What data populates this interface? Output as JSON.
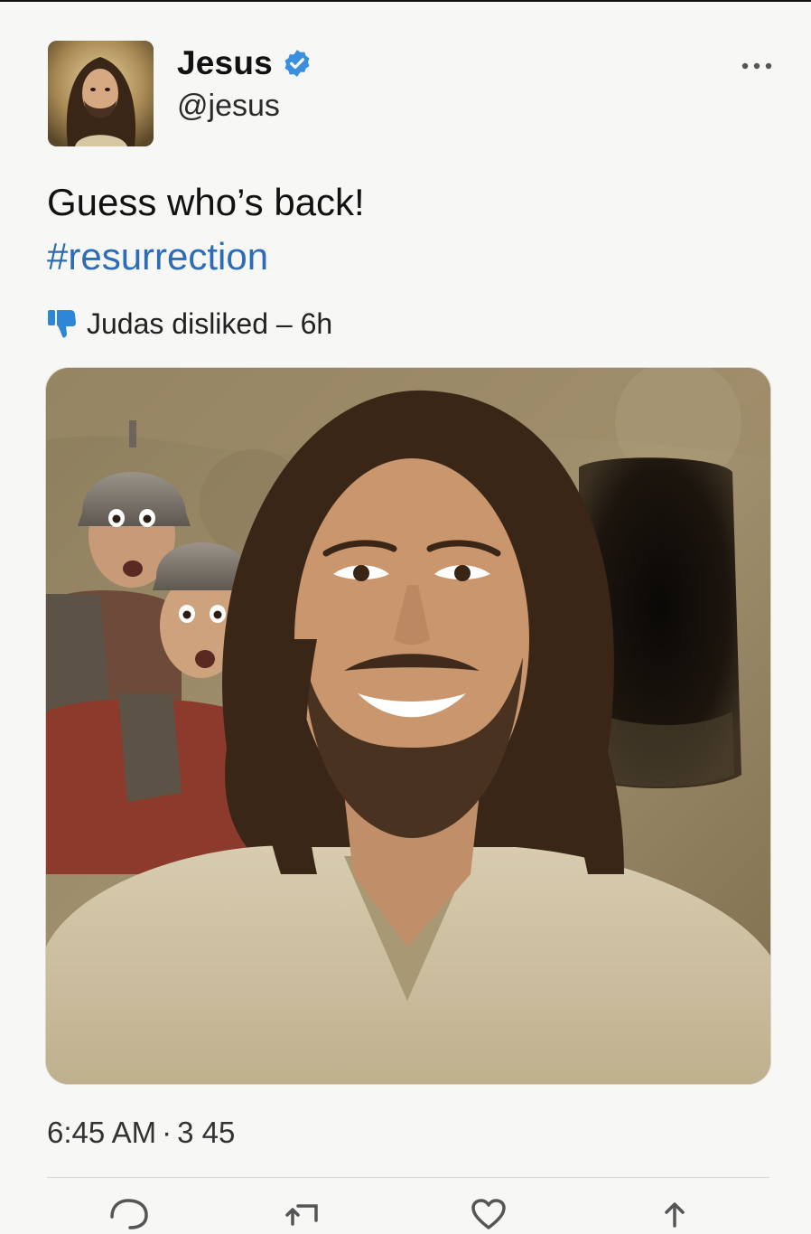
{
  "author": {
    "display_name": "Jesus",
    "handle": "@jesus",
    "verified": true,
    "verified_color": "#3b8ee0"
  },
  "tweet": {
    "text": "Guess who’s back!",
    "hashtag": "#resurrection",
    "hashtag_color": "#2d6db5"
  },
  "reaction": {
    "icon": "thumbs-down-icon",
    "icon_color": "#2d86d6",
    "text": "Judas disliked – 6h"
  },
  "meta": {
    "time": "6:45 AM",
    "separator": "·",
    "count": "3 45"
  },
  "media": {
    "description_icon": "selfie-photo"
  },
  "actions": [
    {
      "icon": "reply-icon"
    },
    {
      "icon": "retweet-icon"
    },
    {
      "icon": "like-icon"
    },
    {
      "icon": "share-icon"
    }
  ],
  "more_icon": "more-dots-icon"
}
